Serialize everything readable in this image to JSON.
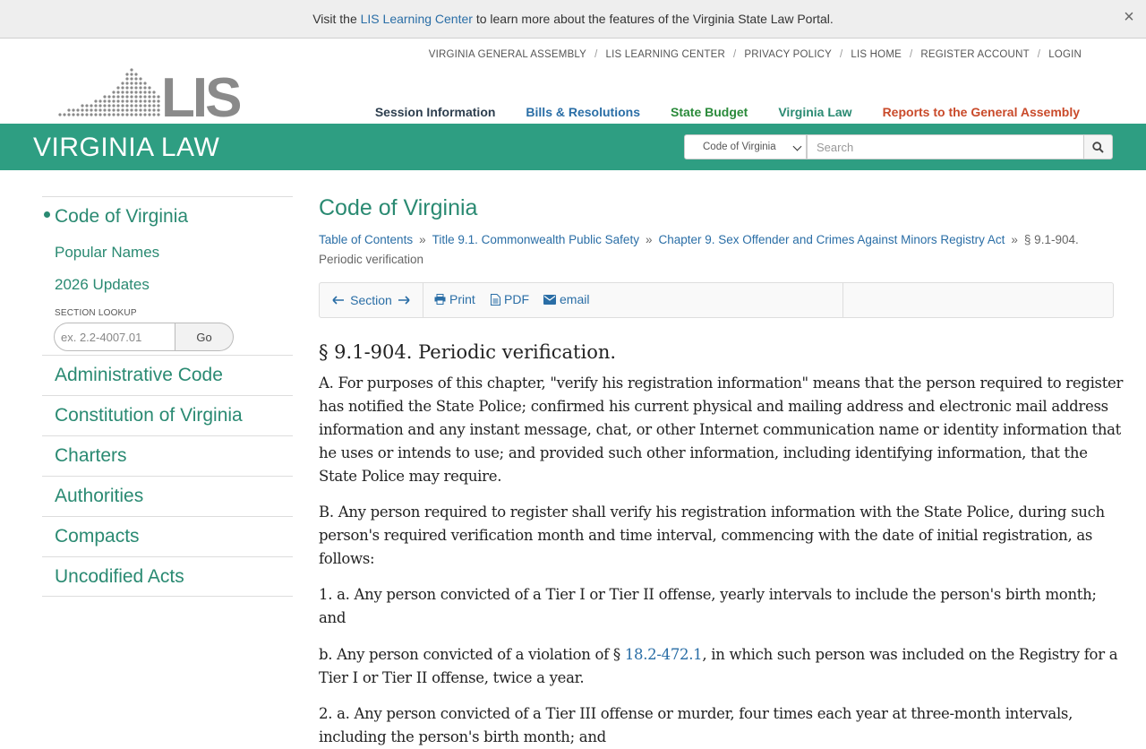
{
  "banner": {
    "prefix": "Visit the",
    "link": "LIS Learning Center",
    "suffix": "to learn more about the features of the Virginia State Law Portal.",
    "close": "×"
  },
  "header": {
    "logo_text": "LIS",
    "top_links": [
      "VIRGINIA GENERAL ASSEMBLY",
      "LIS LEARNING CENTER",
      "PRIVACY POLICY",
      "LIS HOME",
      "REGISTER ACCOUNT",
      "LOGIN"
    ],
    "nav": [
      {
        "label": "Session Information",
        "color": "#2d3e4e"
      },
      {
        "label": "Bills & Resolutions",
        "color": "#2a6ea6"
      },
      {
        "label": "State Budget",
        "color": "#2a8a3a"
      },
      {
        "label": "Virginia Law",
        "color": "#2a8a72"
      },
      {
        "label": "Reports to the General Assembly",
        "color": "#c94a2a"
      }
    ]
  },
  "greenbar": {
    "title": "VIRGINIA LAW",
    "select_value": "Code of Virginia",
    "search_placeholder": "Search",
    "color": "#2e9e82"
  },
  "sidebar": {
    "active": "Code of Virginia",
    "subitems": [
      "Popular Names",
      "2026 Updates"
    ],
    "lookup_label": "SECTION LOOKUP",
    "lookup_placeholder": "ex. 2.2-4007.01",
    "lookup_button": "Go",
    "items": [
      "Administrative Code",
      "Constitution of Virginia",
      "Charters",
      "Authorities",
      "Compacts",
      "Uncodified Acts"
    ]
  },
  "main": {
    "title": "Code of Virginia",
    "breadcrumbs": [
      "Table of Contents",
      "Title 9.1. Commonwealth Public Safety",
      "Chapter 9. Sex Offender and Crimes Against Minors Registry Act"
    ],
    "current_a": "§ 9.1-904.",
    "current_b": "Periodic verification",
    "toolbar": {
      "section": "Section",
      "print": "Print",
      "pdf": "PDF",
      "email": "email"
    },
    "section_title": "§ 9.1-904. Periodic verification.",
    "paragraphs": {
      "a": "A. For purposes of this chapter, \"verify his registration information\" means that the person required to register has notified the State Police; confirmed his current physical and mailing address and electronic mail address information and any instant message, chat, or other Internet communication name or identity information that he uses or intends to use; and provided such other information, including identifying information, that the State Police may require.",
      "b": "B. Any person required to register shall verify his registration information with the State Police, during such person's required verification month and time interval, commencing with the date of initial registration, as follows:",
      "c": "1. a. Any person convicted of a Tier I or Tier II offense, yearly intervals to include the person's birth month; and",
      "d_pre": "b. Any person convicted of a violation of §",
      "d_link": "18.2-472.1",
      "d_post": ", in which such person was included on the Registry for a Tier I or Tier II offense, twice a year.",
      "e": "2. a. Any person convicted of a Tier III offense or murder, four times each year at three-month intervals, including the person's birth month; and"
    }
  }
}
